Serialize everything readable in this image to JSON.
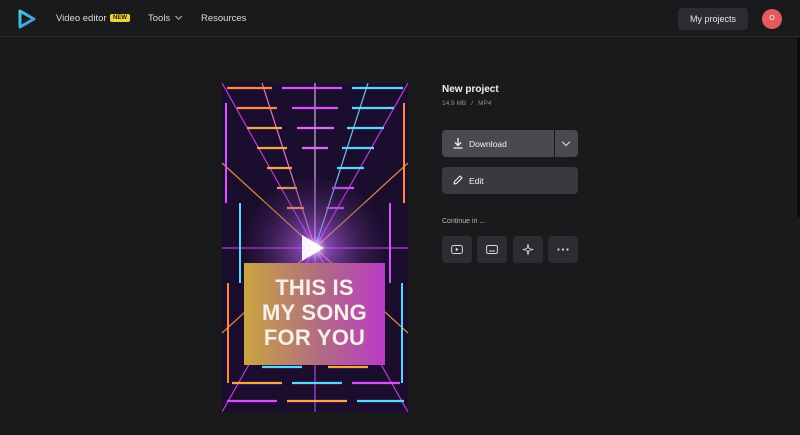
{
  "header": {
    "nav_video_editor": "Video editor",
    "badge_new": "NEW",
    "nav_tools": "Tools",
    "nav_resources": "Resources",
    "my_projects": "My projects",
    "avatar_initial": "O"
  },
  "project": {
    "title": "New project",
    "size": "14.9 MB",
    "separator": "/",
    "format": "MP4"
  },
  "preview": {
    "caption_lines": [
      "THIS IS",
      "MY SONG",
      "FOR YOU"
    ]
  },
  "actions": {
    "download_label": "Download",
    "edit_label": "Edit",
    "continue_label": "Continue in ..."
  },
  "icons": {
    "logo": "play-logo-icon",
    "download": "download-icon",
    "edit": "pencil-icon",
    "continue_options": [
      "youtube-icon",
      "subtitles-icon",
      "sparkle-icon",
      "more-icon"
    ]
  },
  "colors": {
    "background": "#1a191c",
    "button": "#4a4950",
    "avatar": "#e55a5c",
    "badge": "#f2d23c"
  }
}
